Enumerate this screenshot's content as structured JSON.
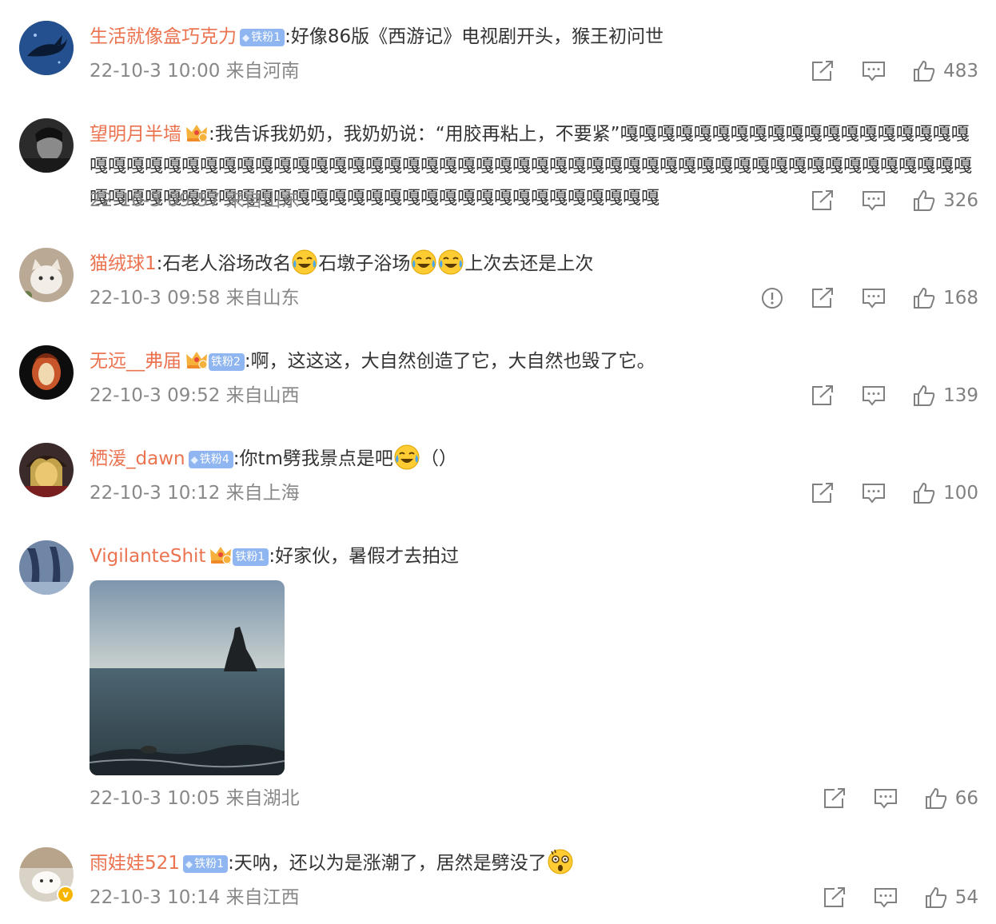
{
  "comments": [
    {
      "username": "生活就像盒巧克力",
      "badge": "铁粉1",
      "text": ":好像86版《西游记》电视剧开头，猴王初问世",
      "time": "22-10-3 10:00",
      "location": "来自河南",
      "likes": "483"
    },
    {
      "username": "望明月半墙",
      "text": ":我告诉我奶奶，我奶奶说：“用胶再粘上，不要紧”嘎嘎嘎嘎嘎嘎嘎嘎嘎嘎嘎嘎嘎嘎嘎嘎嘎嘎嘎嘎嘎嘎嘎嘎嘎嘎嘎嘎嘎嘎嘎嘎嘎嘎嘎嘎嘎嘎嘎嘎嘎嘎嘎嘎嘎嘎嘎嘎嘎嘎嘎嘎嘎嘎嘎嘎嘎嘎嘎嘎嘎嘎嘎嘎嘎嘎嘎嘎嘎嘎嘎嘎嘎嘎嘎嘎嘎嘎嘎嘎嘎嘎嘎嘎嘎嘎嘎嘎嘎嘎嘎嘎嘎嘎嘎嘎嘎嘎",
      "time": "22-10-3 09:57",
      "location": "来自山东",
      "likes": "326"
    },
    {
      "username": "猫绒球1",
      "text_parts": [
        ":石老人浴场改名",
        "石墩子浴场",
        "上次去还是上次"
      ],
      "time": "22-10-3 09:58",
      "location": "来自山东",
      "likes": "168"
    },
    {
      "username": "无远__弗届",
      "badge": "铁粉2",
      "text": ":啊，这这这，大自然创造了它，大自然也毁了它。",
      "time": "22-10-3 09:52",
      "location": "来自山西",
      "likes": "139"
    },
    {
      "username": "栖湲_dawn",
      "badge": "铁粉4",
      "text_parts": [
        ":你tm劈我景点是吧",
        "（）"
      ],
      "time": "22-10-3 10:12",
      "location": "来自上海",
      "likes": "100"
    },
    {
      "username": "VigilanteShit",
      "badge": "铁粉1",
      "text": ":好家伙，暑假才去拍过",
      "time": "22-10-3 10:05",
      "location": "来自湖北",
      "likes": "66"
    },
    {
      "username": "雨娃娃521",
      "badge": "铁粉1",
      "text": ":天呐，还以为是涨潮了，居然是劈没了",
      "time": "22-10-3 10:14",
      "location": "来自江西",
      "likes": "54"
    }
  ],
  "icons": {
    "share": "share-icon",
    "comment": "comment-icon",
    "like": "like-icon",
    "report": "report-icon"
  },
  "colors": {
    "username": "#eb7350",
    "meta": "#888888",
    "badge": "#8fb6f0"
  }
}
